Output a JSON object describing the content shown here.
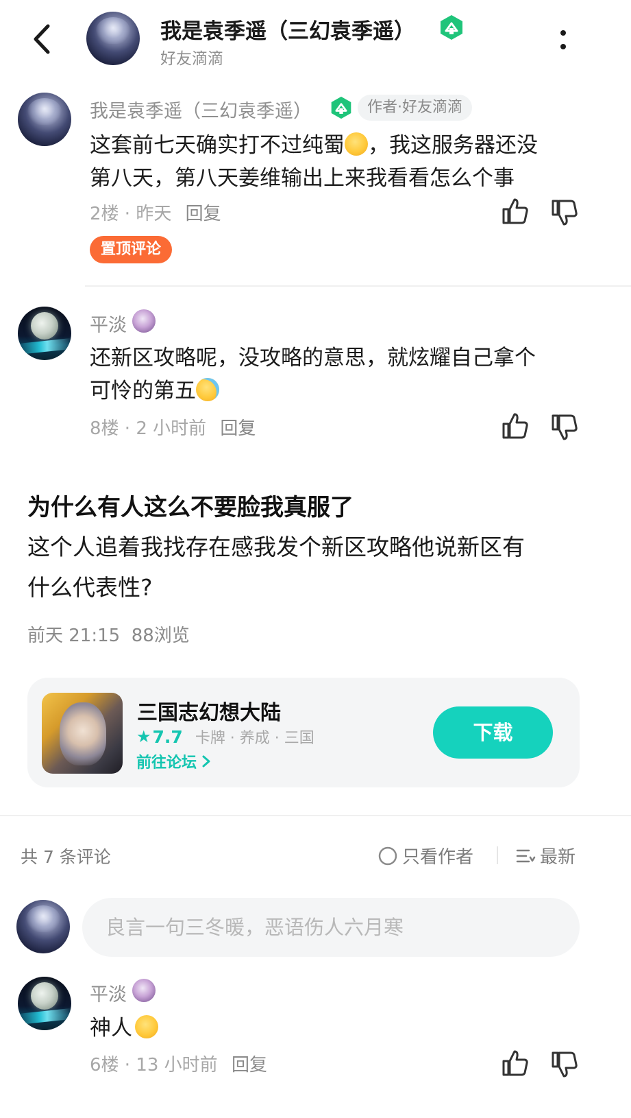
{
  "header": {
    "title": "我是袁季遥（三幻袁季遥）",
    "subtitle": "好友滴滴"
  },
  "pinned_comment": {
    "author": "我是袁季遥（三幻袁季遥）",
    "tag": "作者·好友滴滴",
    "text_line1": "这套前七天确实打不过纯蜀",
    "text_line1_after": "，我这服务器还没",
    "text_line2": "第八天，第八天姜维输出上来我看看怎么个事",
    "meta": "2楼 · 昨天",
    "reply": "回复",
    "pin_label": "置顶评论"
  },
  "comment_2": {
    "author": "平淡",
    "text_line1": "还新区攻略呢，没攻略的意思，就炫耀自己拿个",
    "text_line2": "可怜的第五",
    "meta": "8楼 · 2 小时前",
    "reply": "回复"
  },
  "post": {
    "title": "为什么有人这么不要脸我真服了",
    "body_line1": "这个人追着我找存在感我发个新区攻略他说新区有",
    "body_line2": "什么代表性?",
    "meta": "前天 21:15  88浏览"
  },
  "game_card": {
    "name": "三国志幻想大陆",
    "rating": "7.7",
    "tags": "卡牌 · 养成 · 三国",
    "forum_link": "前往论坛",
    "download_label": "下载"
  },
  "comments_bar": {
    "count_label": "共 7 条评论",
    "author_only_label": "只看作者",
    "sort_label": "最新"
  },
  "comment_input": {
    "placeholder": "良言一句三冬暖，恶语伤人六月寒"
  },
  "comment_3": {
    "author": "平淡",
    "text": "神人",
    "meta": "6楼 · 13 小时前",
    "reply": "回复"
  },
  "colors": {
    "accent_green": "#1fc47a",
    "download_teal": "#15d2bd",
    "pin_orange": "#fb6b35",
    "forum_teal": "#14c5b0"
  }
}
